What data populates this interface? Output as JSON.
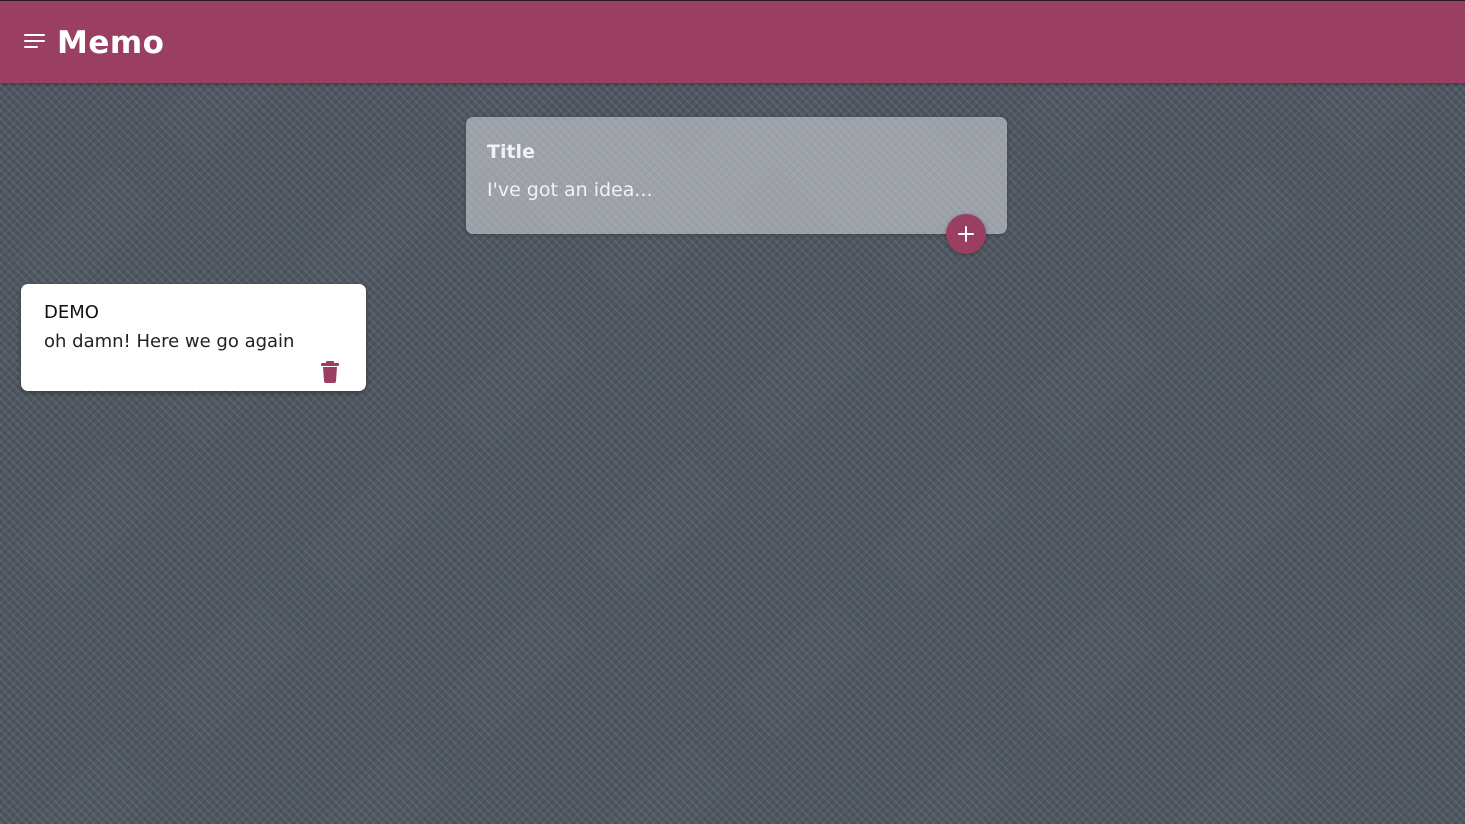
{
  "header": {
    "title": "Memo",
    "menu_icon": "menu-icon",
    "background_color": "#9b3f62"
  },
  "create_note": {
    "title_placeholder": "Title",
    "content_placeholder": "I've got an idea...",
    "add_icon": "plus-icon",
    "accent_color": "#9b3f62"
  },
  "notes": [
    {
      "title": "DEMO",
      "content": "oh damn! Here we go again",
      "delete_icon": "trash-icon"
    }
  ]
}
